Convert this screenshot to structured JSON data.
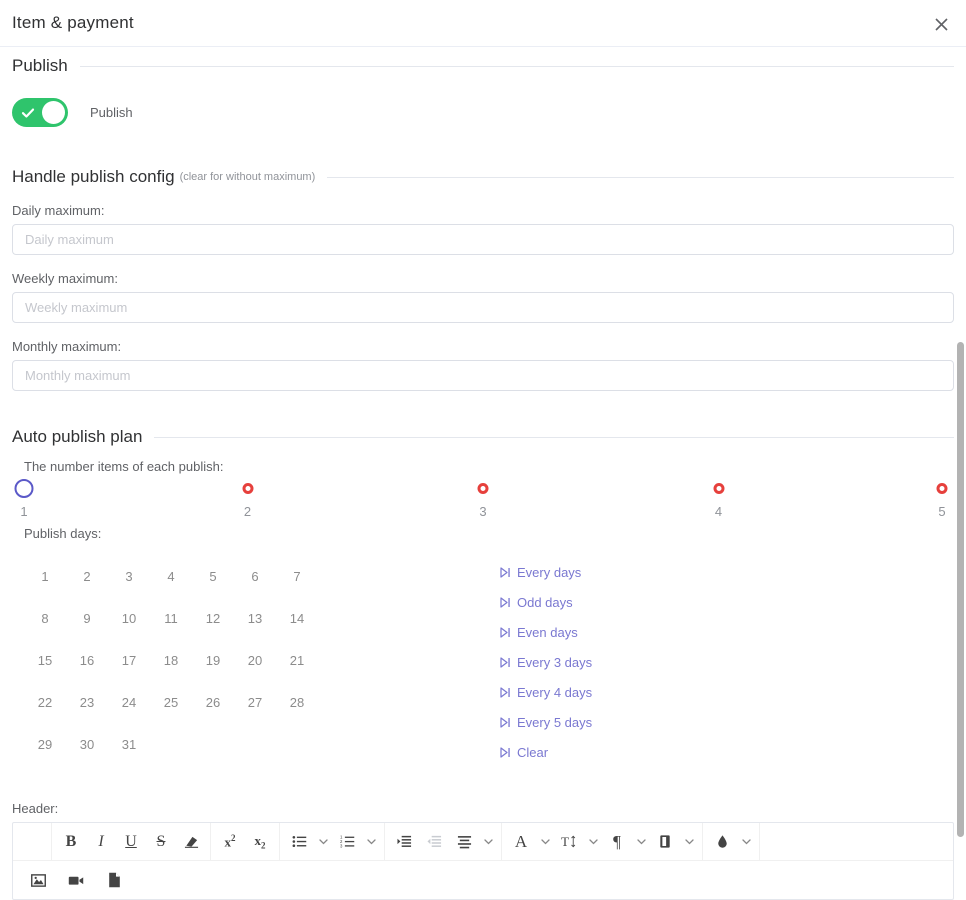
{
  "dialog": {
    "title": "Item & payment",
    "close_icon": "close-icon"
  },
  "sections": {
    "publish": {
      "title": "Publish",
      "toggle_label": "Publish",
      "toggle_on": true,
      "toggle_color": "#2fc46c"
    },
    "handle_config": {
      "title": "Handle publish config",
      "subtitle": "(clear for without maximum)",
      "fields": [
        {
          "label": "Daily maximum:",
          "placeholder": "Daily maximum",
          "value": ""
        },
        {
          "label": "Weekly maximum:",
          "placeholder": "Weekly maximum",
          "value": ""
        },
        {
          "label": "Monthly maximum:",
          "placeholder": "Monthly maximum",
          "value": ""
        }
      ]
    },
    "auto_publish": {
      "title": "Auto publish plan",
      "slider_label": "The number items of each publish:",
      "days_label": "Publish days:"
    }
  },
  "slider": {
    "value": 1,
    "min": 1,
    "max": 5,
    "handle_color": "#5b59c8",
    "mark_color": "#e6403c",
    "marks": [
      {
        "value": 1,
        "label": "1",
        "selected": true
      },
      {
        "value": 2,
        "label": "2",
        "selected": false
      },
      {
        "value": 3,
        "label": "3",
        "selected": false
      },
      {
        "value": 4,
        "label": "4",
        "selected": false
      },
      {
        "value": 5,
        "label": "5",
        "selected": false
      }
    ]
  },
  "publish_days": {
    "days": [
      "1",
      "2",
      "3",
      "4",
      "5",
      "6",
      "7",
      "8",
      "9",
      "10",
      "11",
      "12",
      "13",
      "14",
      "15",
      "16",
      "17",
      "18",
      "19",
      "20",
      "21",
      "22",
      "23",
      "24",
      "25",
      "26",
      "27",
      "28",
      "29",
      "30",
      "31"
    ],
    "selected": [],
    "quick_links": [
      {
        "label": "Every days",
        "icon": "step-forward-icon"
      },
      {
        "label": "Odd days",
        "icon": "step-forward-icon"
      },
      {
        "label": "Even days",
        "icon": "step-forward-icon"
      },
      {
        "label": "Every 3 days",
        "icon": "step-forward-icon"
      },
      {
        "label": "Every 4 days",
        "icon": "step-forward-icon"
      },
      {
        "label": "Every 5 days",
        "icon": "step-forward-icon"
      },
      {
        "label": "Clear",
        "icon": "step-forward-icon"
      }
    ],
    "link_color": "#7a78d1"
  },
  "editor": {
    "label": "Header:",
    "toolbar": {
      "row1": [
        {
          "group": 1,
          "name": "source-code-button",
          "glyph": "</>",
          "type": "text",
          "caret": false
        },
        {
          "group": 2,
          "name": "bold-button",
          "glyph": "B",
          "type": "bold",
          "caret": false
        },
        {
          "group": 2,
          "name": "italic-button",
          "glyph": "I",
          "type": "italic",
          "caret": false
        },
        {
          "group": 2,
          "name": "underline-button",
          "glyph": "U",
          "type": "under",
          "caret": false
        },
        {
          "group": 2,
          "name": "strikethrough-button",
          "glyph": "S",
          "type": "strike",
          "caret": false
        },
        {
          "group": 2,
          "name": "clear-format-button",
          "glyph": "eraser-icon",
          "type": "icon",
          "caret": false
        },
        {
          "group": 3,
          "name": "superscript-button",
          "glyph": "x2",
          "type": "sup",
          "caret": false
        },
        {
          "group": 3,
          "name": "subscript-button",
          "glyph": "x2",
          "type": "sub",
          "caret": false
        },
        {
          "group": 4,
          "name": "bullet-list-button",
          "glyph": "bullet-list-icon",
          "type": "icon",
          "caret": true
        },
        {
          "group": 4,
          "name": "ordered-list-button",
          "glyph": "ordered-list-icon",
          "type": "icon",
          "caret": true
        },
        {
          "group": 5,
          "name": "indent-button",
          "glyph": "indent-icon",
          "type": "icon",
          "caret": false
        },
        {
          "group": 5,
          "name": "outdent-button",
          "glyph": "outdent-icon",
          "type": "icon",
          "caret": false,
          "disabled": true
        },
        {
          "group": 5,
          "name": "align-button",
          "glyph": "align-icon",
          "type": "icon",
          "caret": true
        },
        {
          "group": 6,
          "name": "font-family-button",
          "glyph": "A",
          "type": "serif",
          "caret": true
        },
        {
          "group": 6,
          "name": "font-size-button",
          "glyph": "font-size-icon",
          "type": "icon",
          "caret": true
        },
        {
          "group": 6,
          "name": "paragraph-button",
          "glyph": "¶",
          "type": "serif",
          "caret": true
        },
        {
          "group": 6,
          "name": "line-height-button",
          "glyph": "fill-block-icon",
          "type": "icon",
          "caret": true
        },
        {
          "group": 7,
          "name": "highlight-color-button",
          "glyph": "droplet-icon",
          "type": "icon",
          "caret": true
        }
      ],
      "row2": [
        {
          "name": "insert-image-button",
          "glyph": "image-icon"
        },
        {
          "name": "insert-video-button",
          "glyph": "video-icon"
        },
        {
          "name": "insert-file-button",
          "glyph": "file-icon"
        }
      ]
    }
  },
  "scrollbar": {
    "name": "vertical-scrollbar"
  }
}
